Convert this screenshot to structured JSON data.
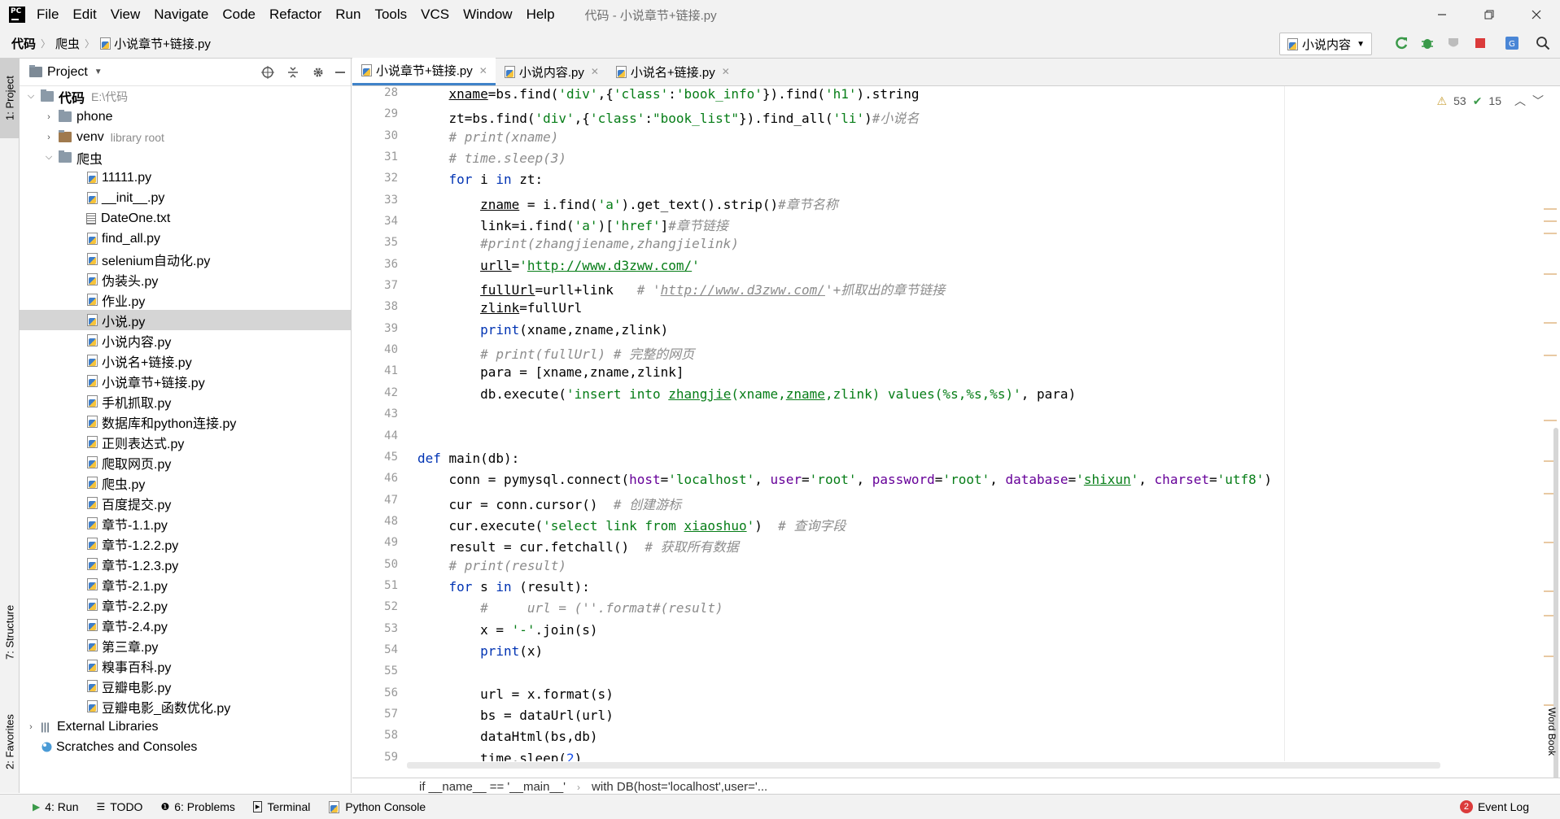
{
  "menubar": {
    "items": [
      {
        "label": "File"
      },
      {
        "label": "Edit"
      },
      {
        "label": "View"
      },
      {
        "label": "Navigate"
      },
      {
        "label": "Code"
      },
      {
        "label": "Refactor"
      },
      {
        "label": "Run"
      },
      {
        "label": "Tools"
      },
      {
        "label": "VCS"
      },
      {
        "label": "Window"
      },
      {
        "label": "Help"
      }
    ],
    "window_title": "代码 - 小说章节+链接.py"
  },
  "navbar": {
    "breadcrumbs": [
      "代码",
      "爬虫",
      "小说章节+链接.py"
    ],
    "run_config": "小说内容"
  },
  "left_strip": {
    "project_tab": "1: Project",
    "structure_tab": "7: Structure",
    "favorites_tab": "2: Favorites"
  },
  "project_panel": {
    "title": "Project",
    "root": {
      "name": "代码",
      "path": "E:\\代码"
    },
    "folders": [
      {
        "name": "phone",
        "note": ""
      },
      {
        "name": "venv",
        "note": "library root"
      },
      {
        "name": "爬虫",
        "note": ""
      }
    ],
    "files": [
      "11111.py",
      "__init__.py",
      "DateOne.txt",
      "find_all.py",
      "selenium自动化.py",
      "伪装头.py",
      "作业.py",
      "小说.py",
      "小说内容.py",
      "小说名+链接.py",
      "小说章节+链接.py",
      "手机抓取.py",
      "数据库和python连接.py",
      "正则表达式.py",
      "爬取网页.py",
      "爬虫.py",
      "百度提交.py",
      "章节-1.1.py",
      "章节-1.2.2.py",
      "章节-1.2.3.py",
      "章节-2.1.py",
      "章节-2.2.py",
      "章节-2.4.py",
      "第三章.py",
      "糗事百科.py",
      "豆瓣电影.py",
      "豆瓣电影_函数优化.py"
    ],
    "selected_file": "小说.py",
    "external_libraries": "External Libraries",
    "scratches": "Scratches and Consoles"
  },
  "editor": {
    "tabs": [
      {
        "label": "小说章节+链接.py",
        "active": true
      },
      {
        "label": "小说内容.py",
        "active": false
      },
      {
        "label": "小说名+链接.py",
        "active": false
      }
    ],
    "warnings": "53",
    "weak_warnings": "15",
    "line_numbers": [
      "28",
      "29",
      "30",
      "31",
      "32",
      "33",
      "34",
      "35",
      "36",
      "37",
      "38",
      "39",
      "40",
      "41",
      "42",
      "43",
      "44",
      "45",
      "46",
      "47",
      "48",
      "49",
      "50",
      "51",
      "52",
      "53",
      "54",
      "55",
      "56",
      "57",
      "58",
      "59"
    ],
    "breadcrumb": [
      "if __name__ == '__main__'",
      "with DB(host='localhost',user='..."
    ]
  },
  "statusbar": {
    "run": "4: Run",
    "todo": "TODO",
    "problems": "6: Problems",
    "terminal": "Terminal",
    "python_console": "Python Console",
    "event_log": "Event Log",
    "event_count": "2",
    "word_book": "Word Book"
  }
}
